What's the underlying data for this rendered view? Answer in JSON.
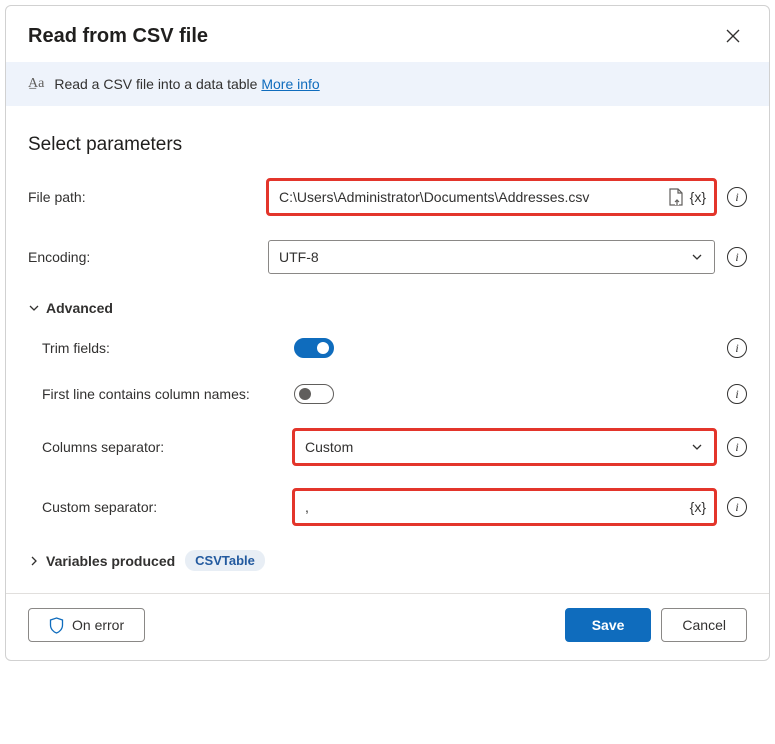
{
  "header": {
    "title": "Read from CSV file"
  },
  "banner": {
    "desc": "Read a CSV file into a data table ",
    "link": "More info"
  },
  "section_title": "Select parameters",
  "fields": {
    "file_path": {
      "label": "File path:",
      "value": "C:\\Users\\Administrator\\Documents\\Addresses.csv"
    },
    "encoding": {
      "label": "Encoding:",
      "value": "UTF-8"
    },
    "advanced_label": "Advanced",
    "trim": {
      "label": "Trim fields:",
      "on": true
    },
    "firstline": {
      "label": "First line contains column names:",
      "on": false
    },
    "separator": {
      "label": "Columns separator:",
      "value": "Custom"
    },
    "custom": {
      "label": "Custom separator:",
      "value": ","
    }
  },
  "vars": {
    "label": "Variables produced",
    "badge": "CSVTable"
  },
  "footer": {
    "onerror": "On error",
    "save": "Save",
    "cancel": "Cancel"
  }
}
